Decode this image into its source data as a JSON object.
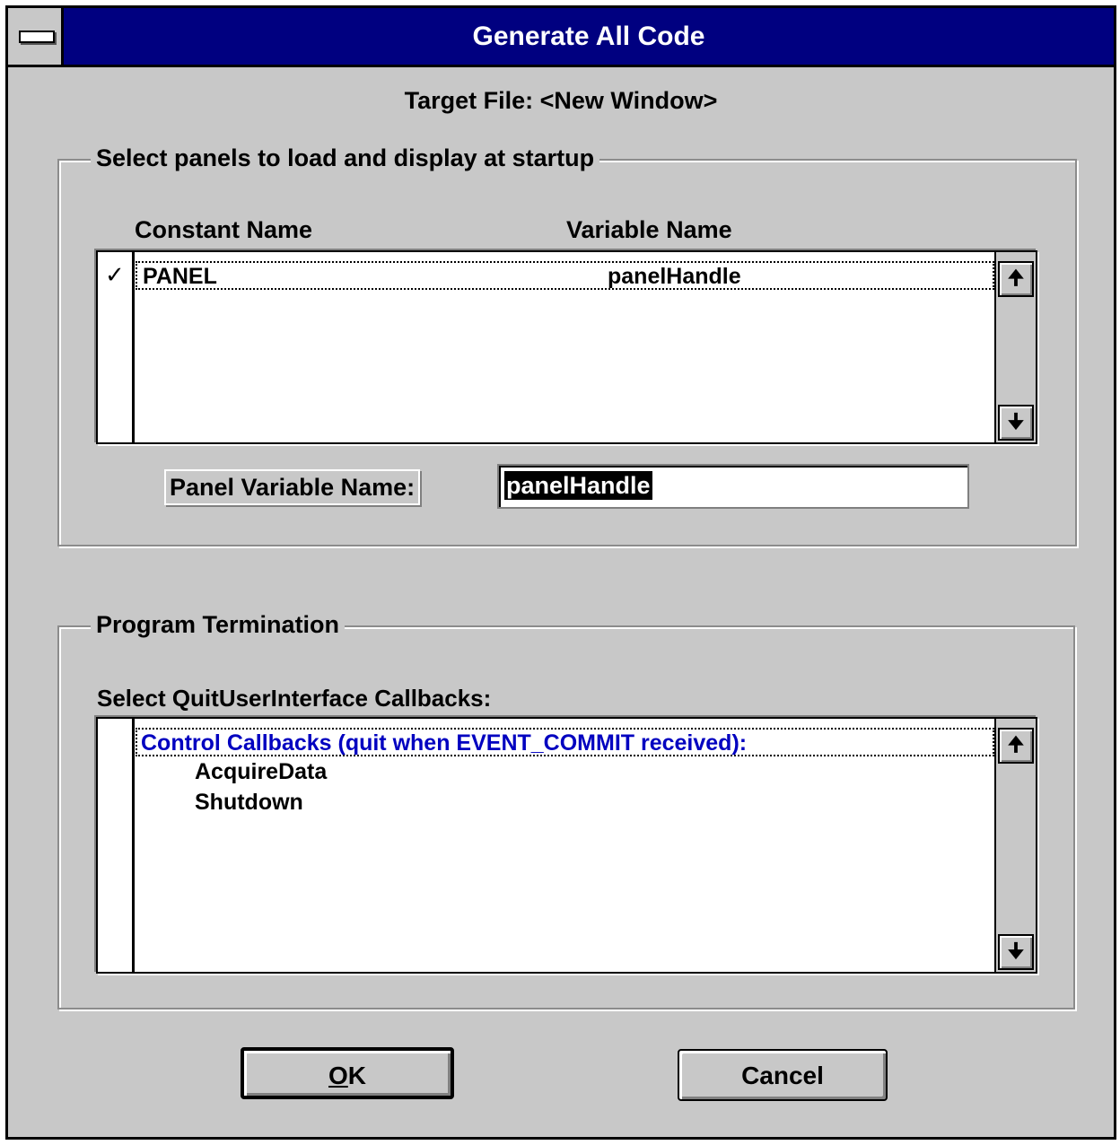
{
  "window": {
    "title": "Generate All Code",
    "sysmenu_icon": "minus-bar-icon"
  },
  "target_file": "Target File: <New Window>",
  "panels_group": {
    "label": "Select panels to load and display at startup",
    "col_constant": "Constant Name",
    "col_variable": "Variable Name",
    "rows": [
      {
        "checked": true,
        "check_mark": "✓",
        "constant": "PANEL",
        "variable": "panelHandle"
      }
    ],
    "panel_var_label": "Panel Variable Name:",
    "panel_var_value": "panelHandle"
  },
  "termination_group": {
    "label": "Program Termination",
    "callbacks_label": "Select QuitUserInterface Callbacks:",
    "heading": "Control Callbacks (quit when EVENT_COMMIT received):",
    "items": [
      "AcquireData",
      "Shutdown"
    ]
  },
  "scroll": {
    "up_glyph": "🠉",
    "down_glyph": "🠋"
  },
  "buttons": {
    "ok_prefix": "",
    "ok_mnemonic": "O",
    "ok_rest": "K",
    "cancel": "Cancel"
  },
  "colors": {
    "title_bar": "#000080",
    "dialog_bg": "#c8c8c8",
    "callback_heading": "#0000c0"
  }
}
